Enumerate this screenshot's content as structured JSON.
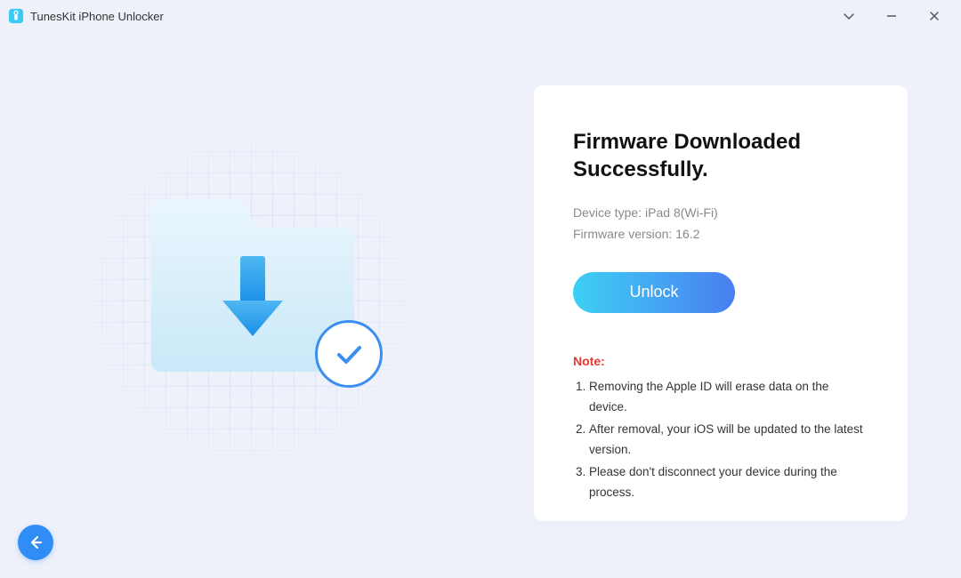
{
  "titlebar": {
    "title": "TunesKit iPhone Unlocker"
  },
  "main": {
    "heading": "Firmware Downloaded Successfully.",
    "device_type_label": "Device type:",
    "device_type_value": "iPad 8(Wi-Fi)",
    "firmware_label": "Firmware version:",
    "firmware_value": "16.2",
    "unlock_button": "Unlock",
    "note_header": "Note:",
    "notes": [
      "Removing the Apple ID will erase data on the device.",
      "After removal, your iOS will be updated to the latest version.",
      "Please don't disconnect your device during the process."
    ]
  }
}
